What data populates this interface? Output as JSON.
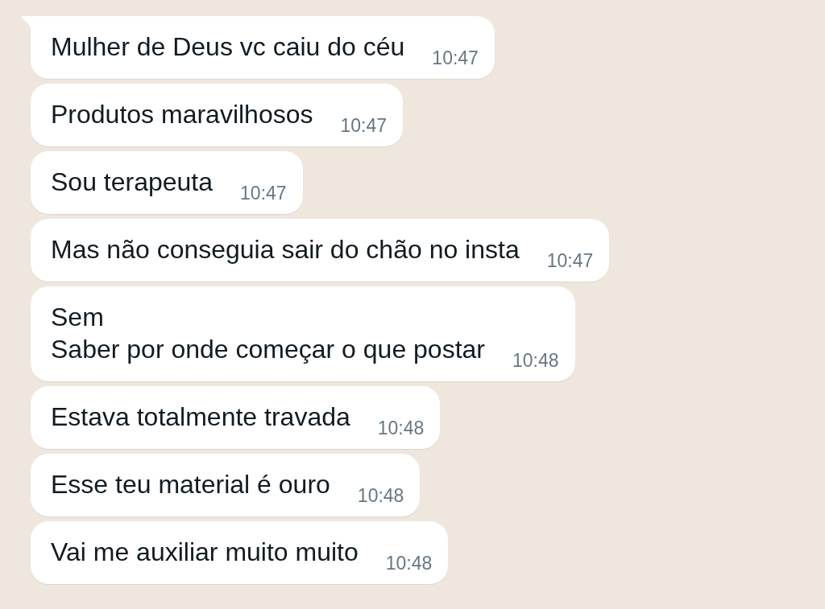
{
  "messages": [
    {
      "text": "Mulher de Deus vc caiu do céu",
      "time": "10:47",
      "tail": true
    },
    {
      "text": "Produtos maravilhosos",
      "time": "10:47",
      "tail": false
    },
    {
      "text": "Sou terapeuta",
      "time": "10:47",
      "tail": false
    },
    {
      "text": "Mas não conseguia sair do chão no insta",
      "time": "10:47",
      "tail": false
    },
    {
      "text": "Sem\nSaber por onde começar o que postar",
      "time": "10:48",
      "tail": false
    },
    {
      "text": "Estava totalmente travada",
      "time": "10:48",
      "tail": false
    },
    {
      "text": "Esse teu material é ouro",
      "time": "10:48",
      "tail": false
    },
    {
      "text": "Vai me auxiliar muito muito",
      "time": "10:48",
      "tail": false
    }
  ]
}
